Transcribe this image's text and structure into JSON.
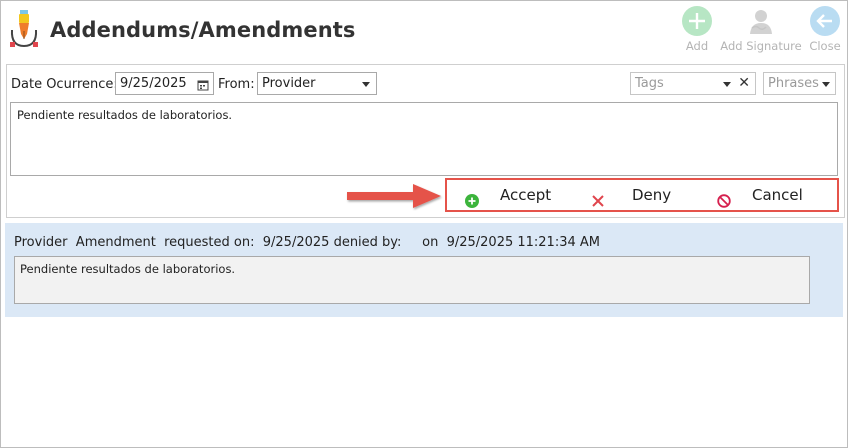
{
  "header": {
    "title": "Addendums/Amendments",
    "toolbar": {
      "add_label": "Add",
      "add_signature_label": "Add Signature",
      "close_label": "Close"
    }
  },
  "form": {
    "date_label": "Date Ocurrence:",
    "date_value": "9/25/2025",
    "from_label": "From:",
    "from_value": "Provider",
    "tags_placeholder": "Tags",
    "phrases_placeholder": "Phrases",
    "note_text": "Pendiente resultados de laboratorios."
  },
  "actions": {
    "accept_label": "Accept",
    "deny_label": "Deny",
    "cancel_label": "Cancel"
  },
  "history": {
    "entries": [
      {
        "source": "Provider",
        "type": "Amendment",
        "requested_label": "requested on:",
        "requested_date": "9/25/2025",
        "denied_label": "denied by:",
        "denied_by": "",
        "on_label": "on",
        "on_datetime": "9/25/2025 11:21:34 AM",
        "text": "Pendiente resultados de laboratorios."
      }
    ]
  },
  "colors": {
    "accent_red": "#e5534a",
    "accept_green": "#3cb43c",
    "deny_red": "#e0454d",
    "cancel_red": "#d6204e",
    "history_bg": "#dbe8f6",
    "toolbar_disabled": "#b4b4b4"
  },
  "icons": {
    "app": "pen-nib-icon",
    "add": "plus-circle-icon",
    "add_signature": "user-signature-icon",
    "close": "arrow-left-circle-icon",
    "calendar": "calendar-icon",
    "accept": "plus-circle-icon",
    "deny": "x-icon",
    "cancel": "ban-icon"
  }
}
